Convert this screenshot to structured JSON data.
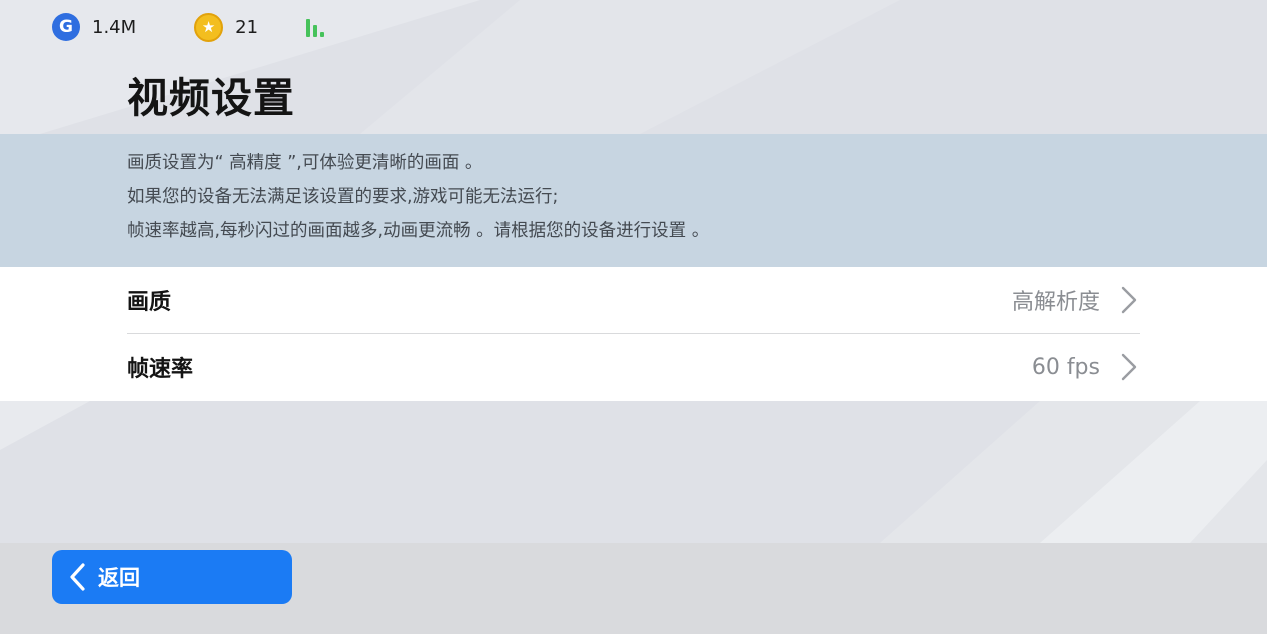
{
  "status_bar": {
    "gems_value": "1.4M",
    "gems_icon": "g-currency-icon",
    "coins_value": "21",
    "coins_icon": "star-coin-icon",
    "signal_icon": "signal-bars-icon",
    "signal_color": "#46c25b"
  },
  "page": {
    "title": "视频设置"
  },
  "info": {
    "lines": [
      "画质设置为“ 高精度 ”,可体验更清晰的画面 。",
      "如果您的设备无法满足该设置的要求,游戏可能无法运行;",
      "帧速率越高,每秒闪过的画面越多,动画更流畅 。请根据您的设备进行设置 。"
    ]
  },
  "settings": [
    {
      "label": "画质",
      "value": "高解析度"
    },
    {
      "label": "帧速率",
      "value": "60 fps"
    }
  ],
  "footer": {
    "back_label": "返回",
    "back_icon": "chevron-left-icon",
    "accent_color": "#1b7bf4"
  }
}
